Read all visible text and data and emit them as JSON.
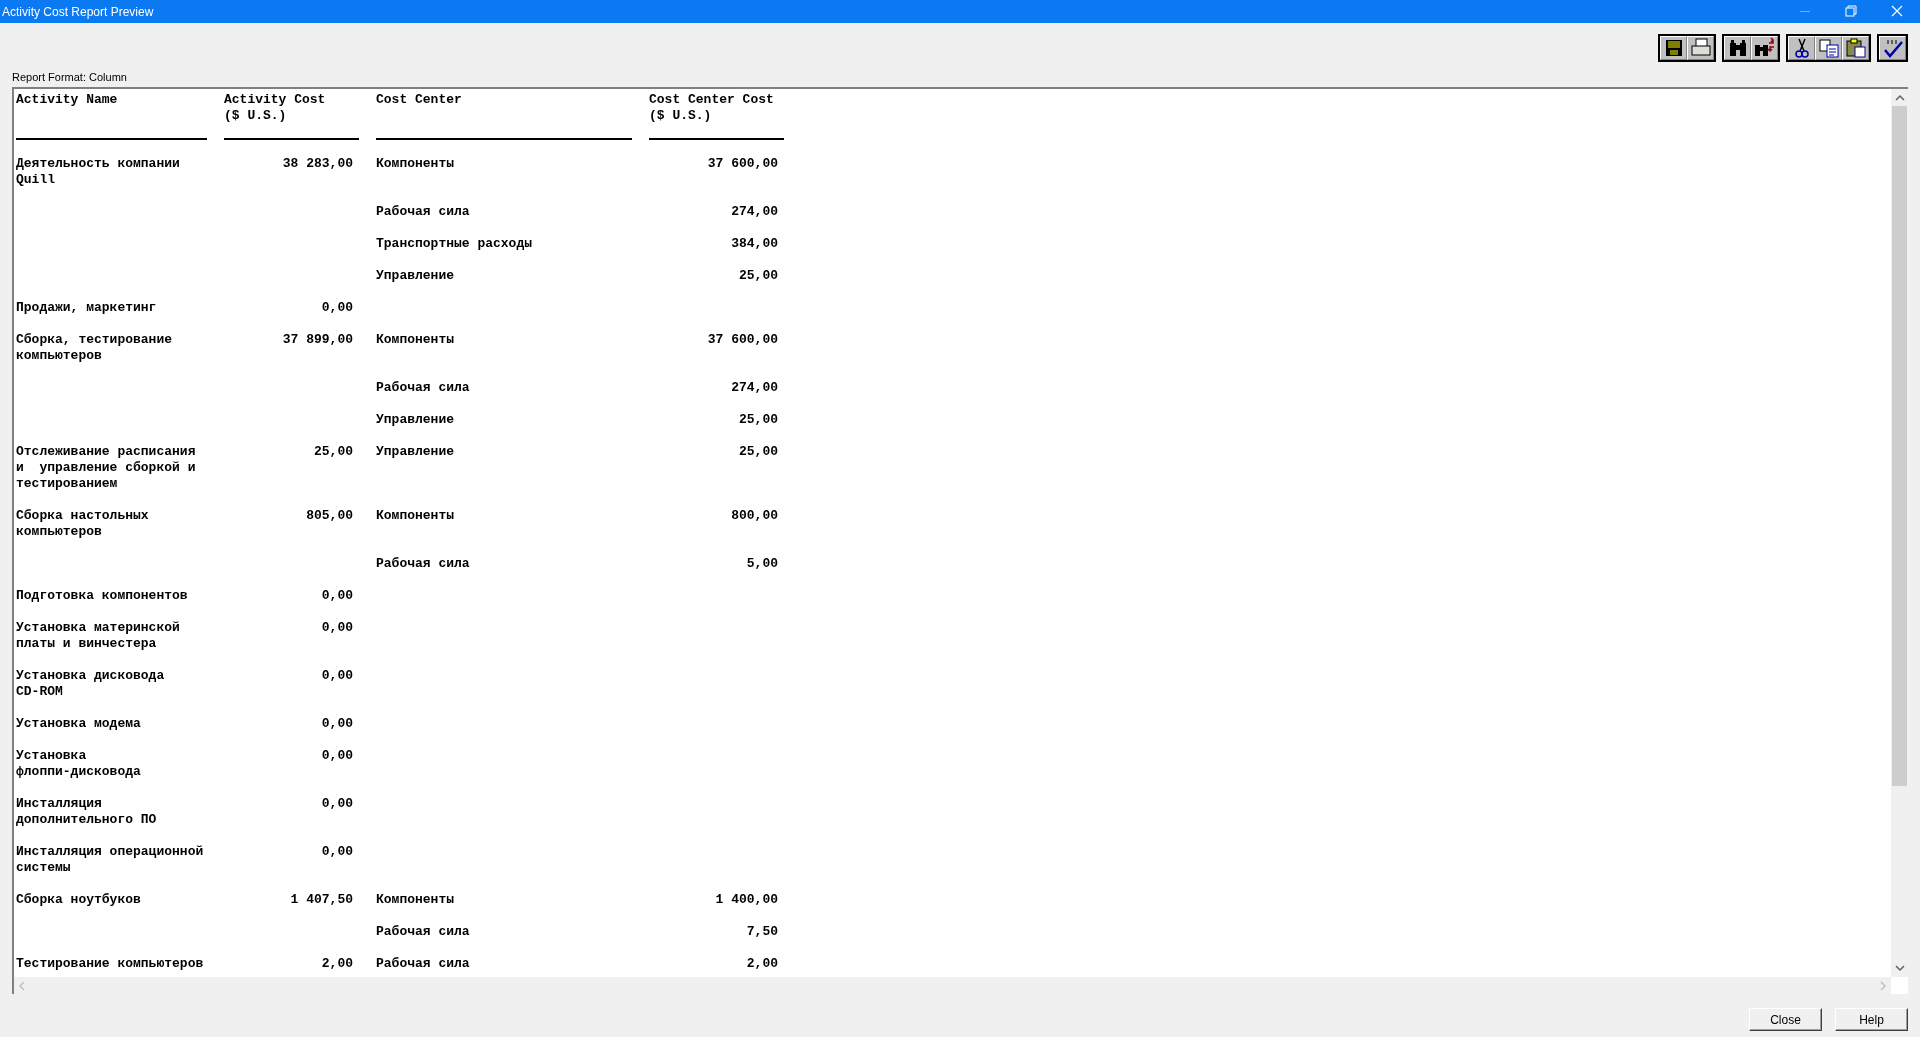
{
  "window": {
    "title": "Activity Cost Report Preview"
  },
  "toolbar": {
    "groups": [
      [
        {
          "kind": "save"
        },
        {
          "kind": "print"
        }
      ],
      [
        {
          "kind": "find"
        },
        {
          "kind": "findnext"
        }
      ],
      [
        {
          "kind": "cut"
        },
        {
          "kind": "copy"
        },
        {
          "kind": "paste"
        }
      ],
      [
        {
          "kind": "spellcheck"
        }
      ]
    ]
  },
  "report_format_label": "Report Format: Column",
  "report": {
    "columns": [
      "Activity Name",
      "Activity Cost\n($ U.S.)",
      "Cost Center",
      "Cost Center Cost\n($ U.S.)"
    ],
    "rows": [
      {
        "activity_name": "Деятельность компании\nQuill",
        "activity_cost": "38 283,00",
        "cost_center": "Компоненты",
        "cost_center_cost": "37 600,00"
      },
      {
        "cost_center": "Рабочая сила",
        "cost_center_cost": "274,00"
      },
      {
        "cost_center": "Транспортные расходы",
        "cost_center_cost": "384,00"
      },
      {
        "cost_center": "Управление",
        "cost_center_cost": "25,00"
      },
      {
        "activity_name": "Продажи, маркетинг",
        "activity_cost": "0,00"
      },
      {
        "activity_name": "Сборка, тестирование\nкомпьютеров",
        "activity_cost": "37 899,00",
        "cost_center": "Компоненты",
        "cost_center_cost": "37 600,00"
      },
      {
        "cost_center": "Рабочая сила",
        "cost_center_cost": "274,00"
      },
      {
        "cost_center": "Управление",
        "cost_center_cost": "25,00"
      },
      {
        "activity_name": "Отслеживание расписания\nи  управление сборкой и\nтестированием",
        "activity_cost": "25,00",
        "cost_center": "Управление",
        "cost_center_cost": "25,00"
      },
      {
        "activity_name": "Сборка настольных\nкомпьютеров",
        "activity_cost": "805,00",
        "cost_center": "Компоненты",
        "cost_center_cost": "800,00"
      },
      {
        "cost_center": "Рабочая сила",
        "cost_center_cost": "5,00"
      },
      {
        "activity_name": "Подготовка компонентов",
        "activity_cost": "0,00"
      },
      {
        "activity_name": "Установка материнской\nплаты и винчестера",
        "activity_cost": "0,00"
      },
      {
        "activity_name": "Установка дисковода\nCD-ROM",
        "activity_cost": "0,00"
      },
      {
        "activity_name": "Установка модема",
        "activity_cost": "0,00"
      },
      {
        "activity_name": "Установка\nфлоппи-дисковода",
        "activity_cost": "0,00"
      },
      {
        "activity_name": "Инсталляция\nдополнительного ПО",
        "activity_cost": "0,00"
      },
      {
        "activity_name": "Инсталляция операционной\nсистемы",
        "activity_cost": "0,00"
      },
      {
        "activity_name": "Сборка ноутбуков",
        "activity_cost": "1 407,50",
        "cost_center": "Компоненты",
        "cost_center_cost": "1 400,00"
      },
      {
        "cost_center": "Рабочая сила",
        "cost_center_cost": "7,50"
      },
      {
        "activity_name": "Тестирование компьютеров",
        "activity_cost": "2,00",
        "cost_center": "Рабочая сила",
        "cost_center_cost": "2,00"
      }
    ]
  },
  "buttons": [
    "Close",
    "Help"
  ]
}
